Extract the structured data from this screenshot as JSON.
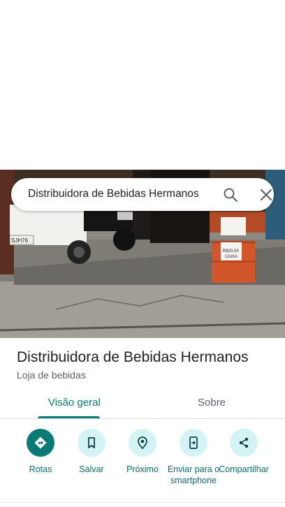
{
  "search": {
    "query": "Distribuidora de Bebidas Hermanos"
  },
  "photo_text": {
    "license_plate": "SJH76",
    "sign_main": "R$20,00",
    "sign_unit": "CAIXA"
  },
  "place": {
    "name": "Distribuidora de Bebidas Hermanos",
    "category": "Loja de bebidas"
  },
  "tabs": [
    {
      "label": "Visão geral",
      "selected": true
    },
    {
      "label": "Sobre",
      "selected": false
    }
  ],
  "actions": [
    {
      "label": "Rotas",
      "icon": "directions-icon"
    },
    {
      "label": "Salvar",
      "icon": "bookmark-icon"
    },
    {
      "label": "Próximo",
      "icon": "nearby-icon"
    },
    {
      "label": "Enviar para o smartphone",
      "icon": "send-to-phone-icon"
    },
    {
      "label": "Compartilhar",
      "icon": "share-icon"
    }
  ],
  "colors": {
    "accent": "#0b7a75",
    "action_bg": "#d4f3f5"
  }
}
